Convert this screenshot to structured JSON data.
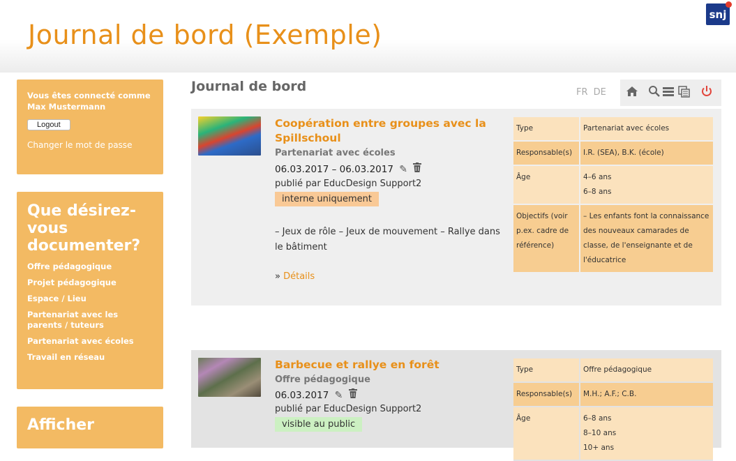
{
  "header": {
    "title": "Journal de bord (Exemple)",
    "logo_text": "snj"
  },
  "sidebar": {
    "logged_in_label": "Vous êtes connecté comme",
    "user_name": "Max Mustermann",
    "logout_label": "Logout",
    "change_password": "Changer le mot de passe",
    "question": "Que désirez-vous documenter?",
    "items": [
      "Offre pédagogique",
      "Projet pédagogique",
      "Espace / Lieu",
      "Partenariat avec les parents / tuteurs",
      "Partenariat avec écoles",
      "Travail en réseau"
    ],
    "display_heading": "Afficher"
  },
  "main": {
    "title": "Journal de bord",
    "languages": [
      "FR",
      "DE"
    ],
    "toolbar_icons": [
      "home-icon",
      "search-icon",
      "list-icon",
      "copy-icon",
      "power-icon"
    ]
  },
  "entries": [
    {
      "title": "Coopération entre groupes avec la Spillschoul",
      "category": "Partenariat avec écoles",
      "date": "06.03.2017 – 06.03.2017",
      "published_by": "publié par EducDesign Support2",
      "visibility": "interne uniquement",
      "description": "– Jeux de rôle – Jeux de mouvement – Rallye dans le bâtiment",
      "details_prefix": "»",
      "details_label": "Détails",
      "info": [
        {
          "key": "Type",
          "value": "Partenariat avec écoles"
        },
        {
          "key": "Responsable(s)",
          "value": "I.R. (SEA), B.K. (école)"
        },
        {
          "key": "Âge",
          "value": "4–6 ans\n6–8 ans"
        },
        {
          "key": "Objectifs (voir p.ex. cadre de référence)",
          "value": "– Les enfants font la connaissance des nouveaux camarades de classe, de l'enseignante et de l'éducatrice"
        }
      ]
    },
    {
      "title": "Barbecue et rallye en forêt",
      "category": "Offre pédagogique",
      "date": "06.03.2017",
      "published_by": "publié par EducDesign Support2",
      "visibility": "visible au public",
      "info": [
        {
          "key": "Type",
          "value": "Offre pédagogique"
        },
        {
          "key": "Responsable(s)",
          "value": "M.H.; A.F.; C.B."
        },
        {
          "key": "Âge",
          "value": "6–8 ans\n8–10 ans\n10+ ans"
        }
      ]
    }
  ],
  "colors": {
    "accent": "#e8901a",
    "sidebar": "#f3ba63",
    "internal_badge": "#f9c996",
    "public_badge": "#ccf0c2",
    "power": "#e2443a"
  }
}
